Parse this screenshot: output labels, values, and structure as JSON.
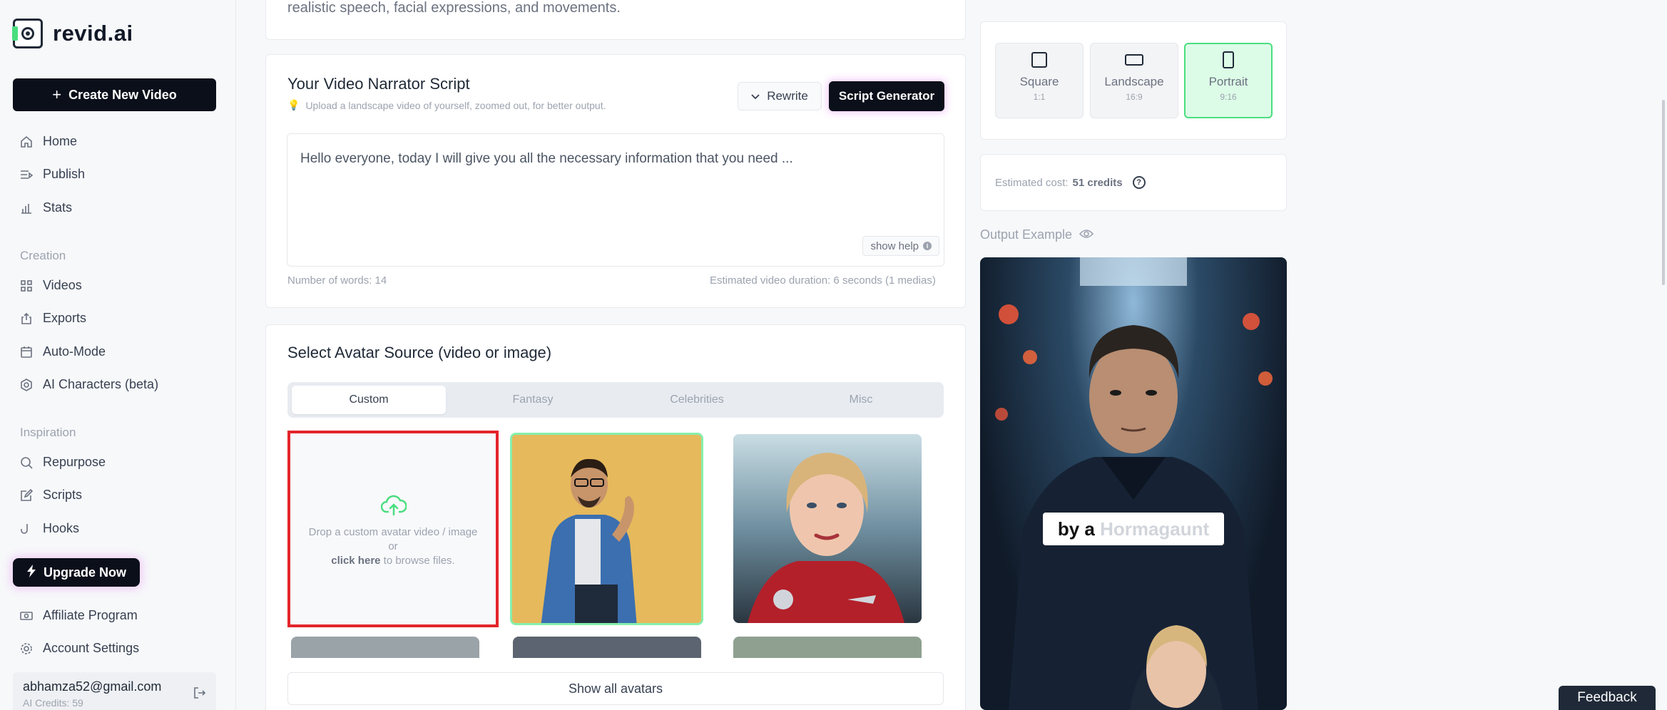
{
  "brand": {
    "name": "revid.ai"
  },
  "sidebar": {
    "create_label": "Create New Video",
    "main_items": [
      {
        "label": "Home",
        "icon": "home-icon"
      },
      {
        "label": "Publish",
        "icon": "publish-icon"
      },
      {
        "label": "Stats",
        "icon": "stats-icon"
      }
    ],
    "creation_heading": "Creation",
    "creation_items": [
      {
        "label": "Videos",
        "icon": "grid-icon"
      },
      {
        "label": "Exports",
        "icon": "export-icon"
      },
      {
        "label": "Auto-Mode",
        "icon": "calendar-icon"
      },
      {
        "label": "AI Characters (beta)",
        "icon": "ai-character-icon"
      }
    ],
    "inspiration_heading": "Inspiration",
    "inspiration_items": [
      {
        "label": "Repurpose",
        "icon": "search-icon"
      },
      {
        "label": "Scripts",
        "icon": "edit-icon"
      },
      {
        "label": "Hooks",
        "icon": "hook-icon"
      }
    ],
    "upgrade_label": "Upgrade Now",
    "bottom_items": [
      {
        "label": "Affiliate Program",
        "icon": "money-icon"
      },
      {
        "label": "Account Settings",
        "icon": "gear-icon"
      }
    ],
    "user": {
      "email": "abhamza52@gmail.com",
      "credits": "AI Credits: 59"
    }
  },
  "intro": {
    "text": "realistic speech, facial expressions, and movements."
  },
  "script": {
    "title": "Your Video Narrator Script",
    "hint": "Upload a landscape video of yourself, zoomed out, for better output.",
    "rewrite_label": "Rewrite",
    "generator_label": "Script Generator",
    "text": "Hello everyone, today I will give you all the necessary information that you need ...",
    "show_help": "show help",
    "word_count": "Number of words: 14",
    "duration": "Estimated video duration: 6 seconds (1 medias)"
  },
  "avatar": {
    "title": "Select Avatar Source (video or image)",
    "tabs": [
      "Custom",
      "Fantasy",
      "Celebrities",
      "Misc"
    ],
    "drop_line1": "Drop a custom avatar video / image",
    "drop_line2": "or",
    "drop_link": "click here",
    "drop_line3": " to browse files.",
    "show_all": "Show all avatars"
  },
  "format": {
    "options": [
      {
        "label": "Square",
        "ratio": "1:1"
      },
      {
        "label": "Landscape",
        "ratio": "16:9"
      },
      {
        "label": "Portrait",
        "ratio": "9:16"
      }
    ],
    "selected": "Portrait"
  },
  "cost": {
    "label": "Estimated cost:",
    "value": "51 credits"
  },
  "output": {
    "label": "Output Example",
    "watermark_prefix": "by a ",
    "watermark_name": "Hormagaunt"
  },
  "feedback": {
    "label": "Feedback"
  },
  "colors": {
    "accent_green": "#4ade80",
    "dark": "#0b0f1a",
    "highlight_red": "#e3252b"
  }
}
